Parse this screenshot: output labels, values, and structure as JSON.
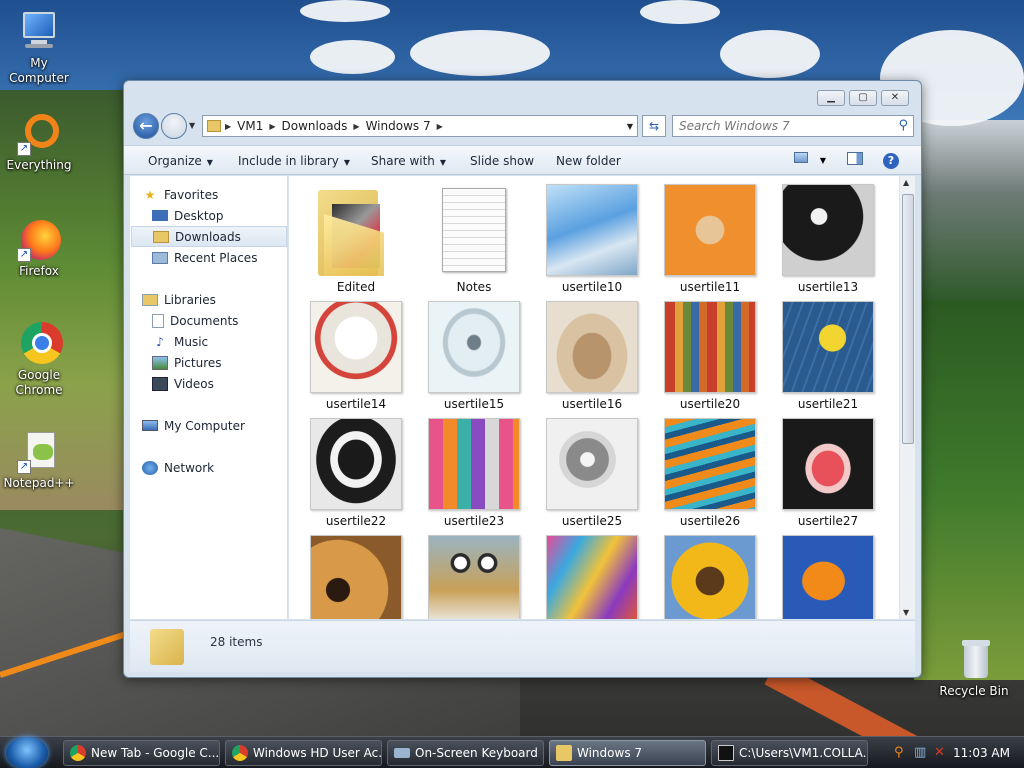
{
  "desktop": {
    "icons": [
      {
        "label": "My Computer"
      },
      {
        "label": "Everything"
      },
      {
        "label": "Firefox"
      },
      {
        "label": "Google Chrome"
      },
      {
        "label": "Notepad++"
      },
      {
        "label": "Recycle Bin"
      }
    ]
  },
  "window": {
    "breadcrumb": [
      "VM1",
      "Downloads",
      "Windows 7"
    ],
    "search_placeholder": "Search Windows 7",
    "toolbar": {
      "organize": "Organize",
      "include_in_library": "Include in library",
      "share_with": "Share with",
      "slide_show": "Slide show",
      "new_folder": "New folder"
    },
    "nav": {
      "favorites": "Favorites",
      "desktop": "Desktop",
      "downloads": "Downloads",
      "recent_places": "Recent Places",
      "libraries": "Libraries",
      "documents": "Documents",
      "music": "Music",
      "pictures": "Pictures",
      "videos": "Videos",
      "my_computer": "My Computer",
      "network": "Network"
    },
    "files": [
      {
        "name": "Edited"
      },
      {
        "name": "Notes"
      },
      {
        "name": "usertile10"
      },
      {
        "name": "usertile11"
      },
      {
        "name": "usertile13"
      },
      {
        "name": "usertile14"
      },
      {
        "name": "usertile15"
      },
      {
        "name": "usertile16"
      },
      {
        "name": "usertile20"
      },
      {
        "name": "usertile21"
      },
      {
        "name": "usertile22"
      },
      {
        "name": "usertile23"
      },
      {
        "name": "usertile25"
      },
      {
        "name": "usertile26"
      },
      {
        "name": "usertile27"
      },
      {
        "name": ""
      },
      {
        "name": ""
      },
      {
        "name": ""
      },
      {
        "name": ""
      },
      {
        "name": ""
      }
    ],
    "details": {
      "count": "28 items"
    }
  },
  "taskbar": {
    "tasks": [
      {
        "label": "New Tab - Google C..."
      },
      {
        "label": "Windows HD User Ac..."
      },
      {
        "label": "On-Screen Keyboard"
      },
      {
        "label": "Windows 7"
      },
      {
        "label": "C:\\Users\\VM1.COLLA..."
      }
    ],
    "clock": "11:03 AM"
  },
  "colors": {
    "accent": "#2e63c0",
    "taskbar": "#1c2026",
    "folder": "#e8c766"
  }
}
